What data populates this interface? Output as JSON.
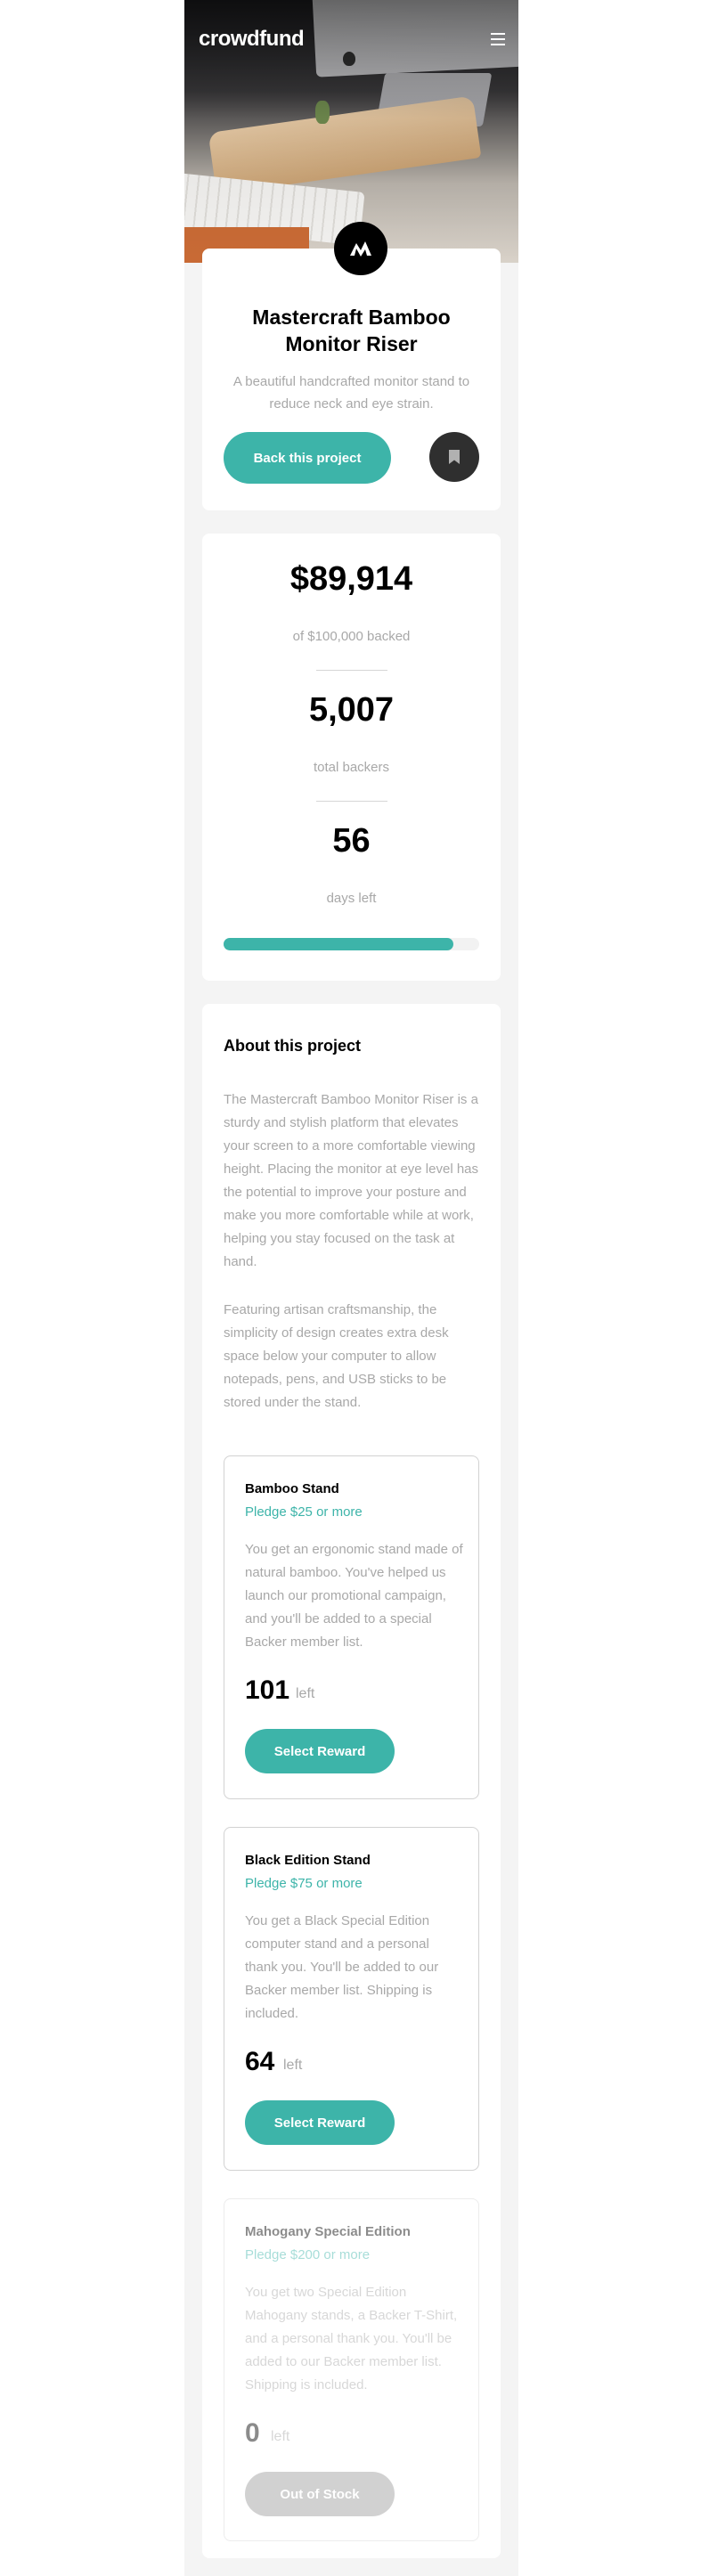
{
  "header": {
    "brand": "crowdfund",
    "menu_icon": "hamburger-icon"
  },
  "hero": {
    "description": "Photo of a wooden monitor riser under a desktop computer"
  },
  "project": {
    "logo_icon": "mastercraft-logo-icon",
    "title": "Mastercraft Bamboo Monitor Riser",
    "subtitle": "A beautiful handcrafted monitor stand to reduce neck and eye strain.",
    "back_label": "Back this project",
    "bookmark_icon": "bookmark-icon"
  },
  "stats": {
    "amount": "$89,914",
    "amount_label": "of $100,000 backed",
    "backers": "5,007",
    "backers_label": "total backers",
    "days": "56",
    "days_label": "days left",
    "progress_fraction": 0.899
  },
  "about": {
    "heading": "About this project",
    "paragraph1": "The Mastercraft Bamboo Monitor Riser is a sturdy and stylish platform that elevates your screen to a more comfortable viewing height. Placing the monitor at eye level has the potential to improve your posture and make you more comfortable while at work, helping you stay focused on the task at hand.",
    "paragraph2": "Featuring artisan craftsmanship, the simplicity of design creates extra desk space below your computer to allow notepads, pens, and USB sticks to be stored under the stand."
  },
  "rewards": [
    {
      "name": "Bamboo Stand",
      "pledge": "Pledge $25 or more",
      "description": "You get an ergonomic stand made of natural bamboo. You've helped us launch our promotional campaign, and you'll be added to a special Backer member list.",
      "count": "101",
      "left_label": "left",
      "button": "Select Reward"
    },
    {
      "name": "Black Edition Stand",
      "pledge": "Pledge $75 or more",
      "description": "You get a Black Special Edition computer stand and a personal thank you. You'll be added to our Backer member list. Shipping is included.",
      "count": "64",
      "left_label": "left",
      "button": "Select Reward"
    },
    {
      "name": "Mahogany Special Edition",
      "pledge": "Pledge $200 or more",
      "description": "You get two Special Edition Mahogany stands, a Backer T-Shirt, and a personal thank you. You'll be added to our Backer member list. Shipping is included.",
      "count": "0",
      "left_label": "left",
      "button": "Out of Stock"
    }
  ],
  "colors": {
    "accent": "#3db4a9",
    "background": "#f4f4f4",
    "text_muted": "#a8a8a8",
    "dark": "#2f2f2f"
  }
}
